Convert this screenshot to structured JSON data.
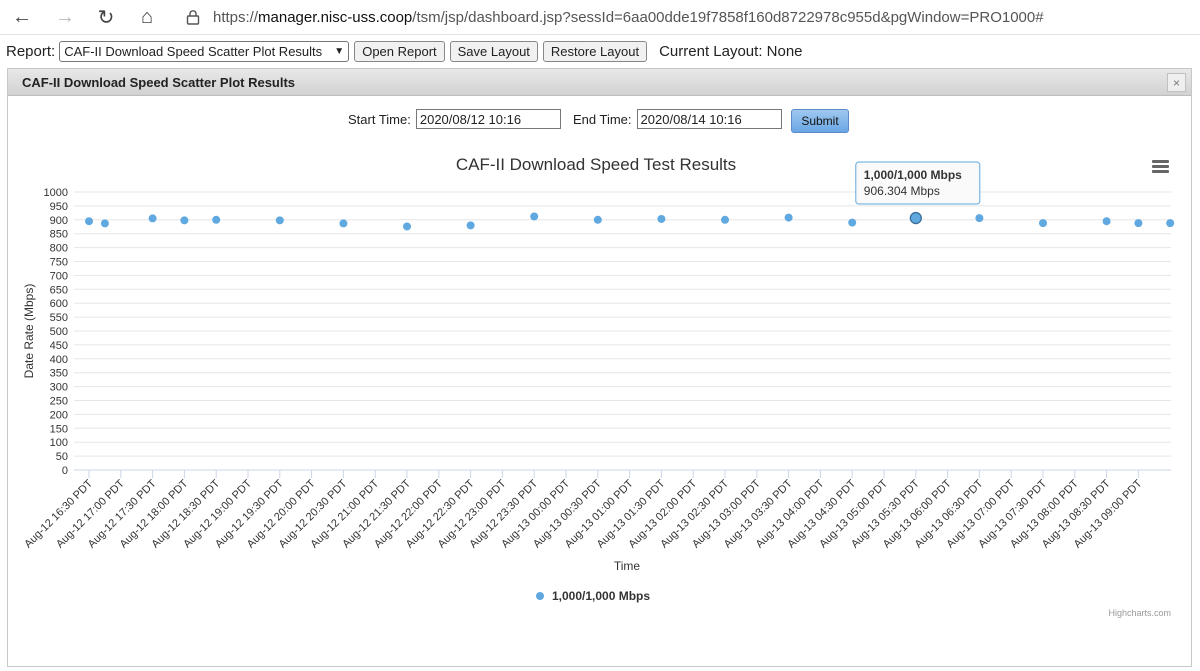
{
  "browser": {
    "url_scheme": "https://",
    "url_host": "manager.nisc-uss.coop",
    "url_path": "/tsm/jsp/dashboard.jsp?sessId=6aa00dde19f7858f160d8722978c955d&pgWindow=PRO1000#"
  },
  "toolbar": {
    "report_label": "Report:",
    "report_selected": "CAF-II Download Speed Scatter Plot Results",
    "open_label": "Open Report",
    "save_label": "Save Layout",
    "restore_label": "Restore Layout",
    "current_layout": "Current Layout: None"
  },
  "panel": {
    "title": "CAF-II Download Speed Scatter Plot Results",
    "close_glyph": "×"
  },
  "form": {
    "start_label": "Start Time:",
    "start_value": "2020/08/12 10:16",
    "end_label": "End Time:",
    "end_value": "2020/08/14 10:16",
    "submit_label": "Submit"
  },
  "chart_data": {
    "type": "scatter",
    "title": "CAF-II Download Speed Test Results",
    "xlabel": "Time",
    "ylabel": "Date Rate (Mbps)",
    "ylim": [
      0,
      1000
    ],
    "yticks": [
      0,
      50,
      100,
      150,
      200,
      250,
      300,
      350,
      400,
      450,
      500,
      550,
      600,
      650,
      700,
      750,
      800,
      850,
      900,
      950,
      1000
    ],
    "xticks": [
      "Aug-12 16:30 PDT",
      "Aug-12 17:00 PDT",
      "Aug-12 17:30 PDT",
      "Aug-12 18:00 PDT",
      "Aug-12 18:30 PDT",
      "Aug-12 19:00 PDT",
      "Aug-12 19:30 PDT",
      "Aug-12 20:00 PDT",
      "Aug-12 20:30 PDT",
      "Aug-12 21:00 PDT",
      "Aug-12 21:30 PDT",
      "Aug-12 22:00 PDT",
      "Aug-12 22:30 PDT",
      "Aug-12 23:00 PDT",
      "Aug-12 23:30 PDT",
      "Aug-13 00:00 PDT",
      "Aug-13 00:30 PDT",
      "Aug-13 01:00 PDT",
      "Aug-13 01:30 PDT",
      "Aug-13 02:00 PDT",
      "Aug-13 02:30 PDT",
      "Aug-13 03:00 PDT",
      "Aug-13 03:30 PDT",
      "Aug-13 04:00 PDT",
      "Aug-13 04:30 PDT",
      "Aug-13 05:00 PDT",
      "Aug-13 05:30 PDT",
      "Aug-13 06:00 PDT",
      "Aug-13 06:30 PDT",
      "Aug-13 07:00 PDT",
      "Aug-13 07:30 PDT",
      "Aug-13 08:00 PDT",
      "Aug-13 08:30 PDT",
      "Aug-13 09:00 PDT"
    ],
    "grid": true,
    "legend_position": "bottom-center",
    "series": [
      {
        "name": "1,000/1,000 Mbps",
        "color": "#5fa8e0",
        "points": [
          {
            "x": "Aug-12 16:30 PDT",
            "y": 895
          },
          {
            "x": "Aug-12 16:45 PDT",
            "y": 887
          },
          {
            "x": "Aug-12 17:30 PDT",
            "y": 905
          },
          {
            "x": "Aug-12 18:00 PDT",
            "y": 898
          },
          {
            "x": "Aug-12 18:30 PDT",
            "y": 900
          },
          {
            "x": "Aug-12 19:30 PDT",
            "y": 898
          },
          {
            "x": "Aug-12 20:30 PDT",
            "y": 887
          },
          {
            "x": "Aug-12 21:30 PDT",
            "y": 876
          },
          {
            "x": "Aug-12 22:30 PDT",
            "y": 880
          },
          {
            "x": "Aug-12 23:30 PDT",
            "y": 912
          },
          {
            "x": "Aug-13 00:30 PDT",
            "y": 900
          },
          {
            "x": "Aug-13 01:30 PDT",
            "y": 903
          },
          {
            "x": "Aug-13 02:30 PDT",
            "y": 900
          },
          {
            "x": "Aug-13 03:30 PDT",
            "y": 908
          },
          {
            "x": "Aug-13 04:30 PDT",
            "y": 890
          },
          {
            "x": "Aug-13 05:30 PDT",
            "y": 906.304
          },
          {
            "x": "Aug-13 06:30 PDT",
            "y": 906
          },
          {
            "x": "Aug-13 07:30 PDT",
            "y": 888
          },
          {
            "x": "Aug-13 08:30 PDT",
            "y": 895
          },
          {
            "x": "Aug-13 09:00 PDT",
            "y": 888
          },
          {
            "x": "Aug-13 09:30 PDT",
            "y": 888
          }
        ]
      }
    ],
    "tooltip": {
      "series": "1,000/1,000 Mbps",
      "value_text": "906.304 Mbps",
      "point_index": 15
    },
    "credits": "Highcharts.com"
  }
}
